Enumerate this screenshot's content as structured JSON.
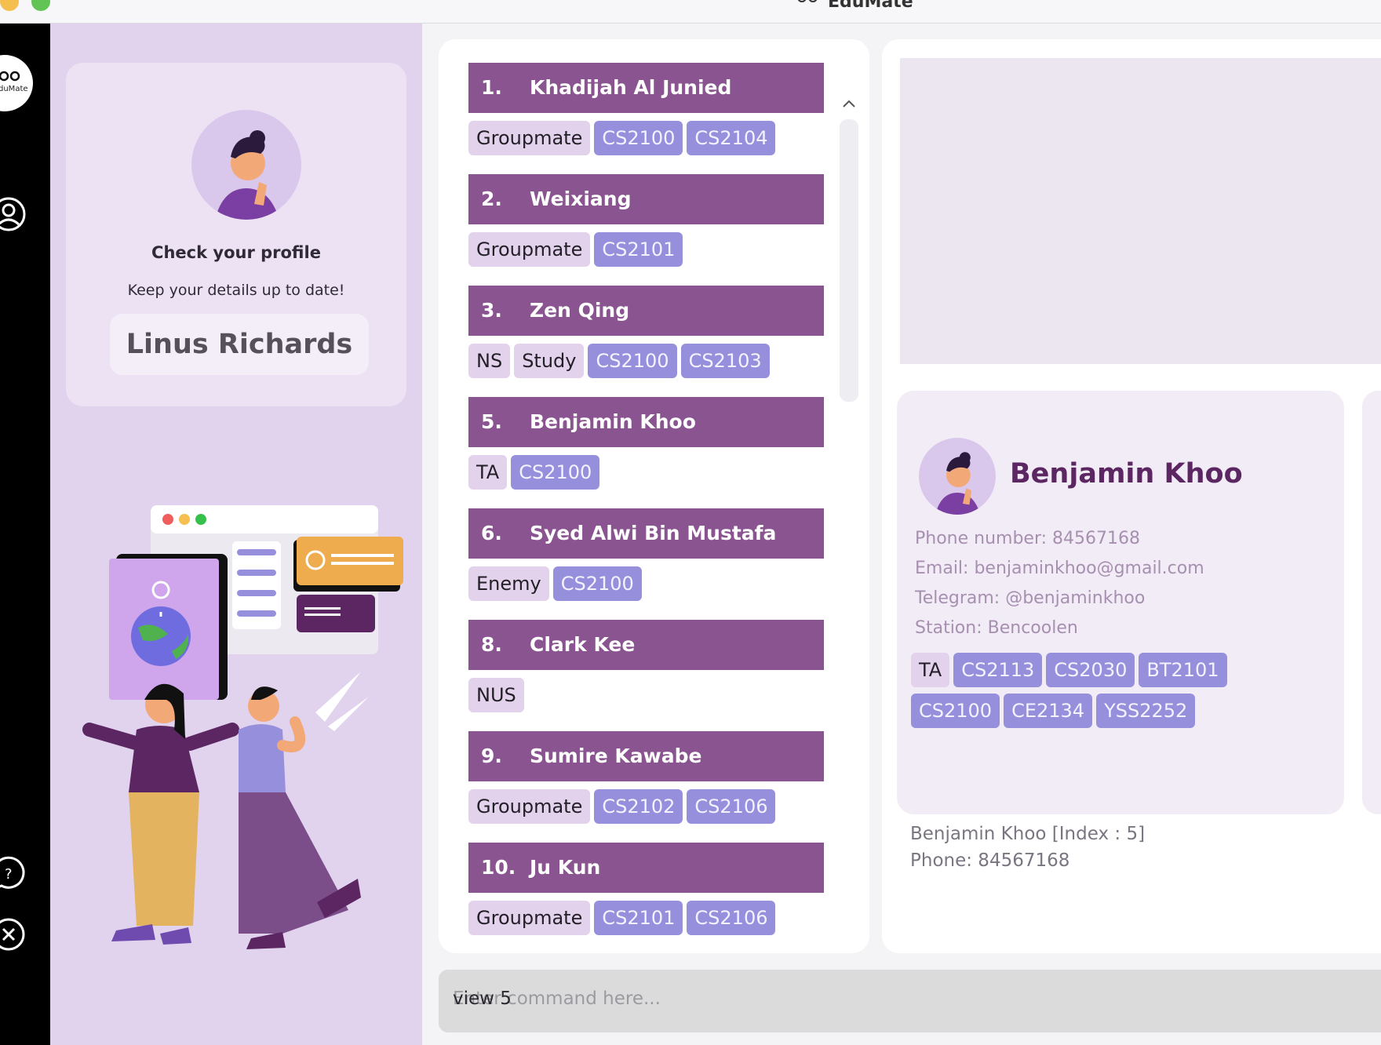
{
  "window": {
    "title": "EduMate"
  },
  "rail": {
    "logo_text": "duMate"
  },
  "profile_card": {
    "title": "Check your profile",
    "subtitle": "Keep your details up to date!",
    "name": "Linus Richards"
  },
  "contacts": [
    {
      "index": "1.",
      "name": "Khadijah Al Junied",
      "labels": [
        "Groupmate"
      ],
      "modules": [
        "CS2100",
        "CS2104"
      ]
    },
    {
      "index": "2.",
      "name": "Weixiang",
      "labels": [
        "Groupmate"
      ],
      "modules": [
        "CS2101"
      ]
    },
    {
      "index": "3.",
      "name": "Zen Qing",
      "labels": [
        "NS",
        "Study"
      ],
      "modules": [
        "CS2100",
        "CS2103"
      ]
    },
    {
      "index": "5.",
      "name": "Benjamin Khoo",
      "labels": [
        "TA"
      ],
      "modules": [
        "CS2100"
      ]
    },
    {
      "index": "6.",
      "name": "Syed Alwi Bin Mustafa",
      "labels": [
        "Enemy"
      ],
      "modules": [
        "CS2100"
      ]
    },
    {
      "index": "8.",
      "name": "Clark Kee",
      "labels": [
        "NUS"
      ],
      "modules": []
    },
    {
      "index": "9.",
      "name": "Sumire Kawabe",
      "labels": [
        "Groupmate"
      ],
      "modules": [
        "CS2102",
        "CS2106"
      ]
    },
    {
      "index": "10.",
      "name": "Ju Kun",
      "labels": [
        "Groupmate"
      ],
      "modules": [
        "CS2101",
        "CS2106"
      ]
    }
  ],
  "detail": {
    "name": "Benjamin Khoo",
    "phone": "Phone number: 84567168",
    "email": "Email: benjaminkhoo@gmail.com",
    "telegram": "Telegram: @benjaminkhoo",
    "station": "Station: Bencoolen",
    "labels": [
      "TA"
    ],
    "modules": [
      "CS2113",
      "CS2030",
      "BT2101",
      "CS2100",
      "CE2134",
      "YSS2252"
    ]
  },
  "result": {
    "line1": "Benjamin Khoo [Index : 5]",
    "line2": "Phone: 84567168"
  },
  "command": {
    "placeholder": "Enter command here...",
    "value": "view 5"
  },
  "colors": {
    "header_purple": "#8a5490",
    "module_tag": "#9690dc",
    "label_tag": "#e2d2ec",
    "side_panel": "#e1d3ee",
    "detail_name": "#5b2662"
  }
}
